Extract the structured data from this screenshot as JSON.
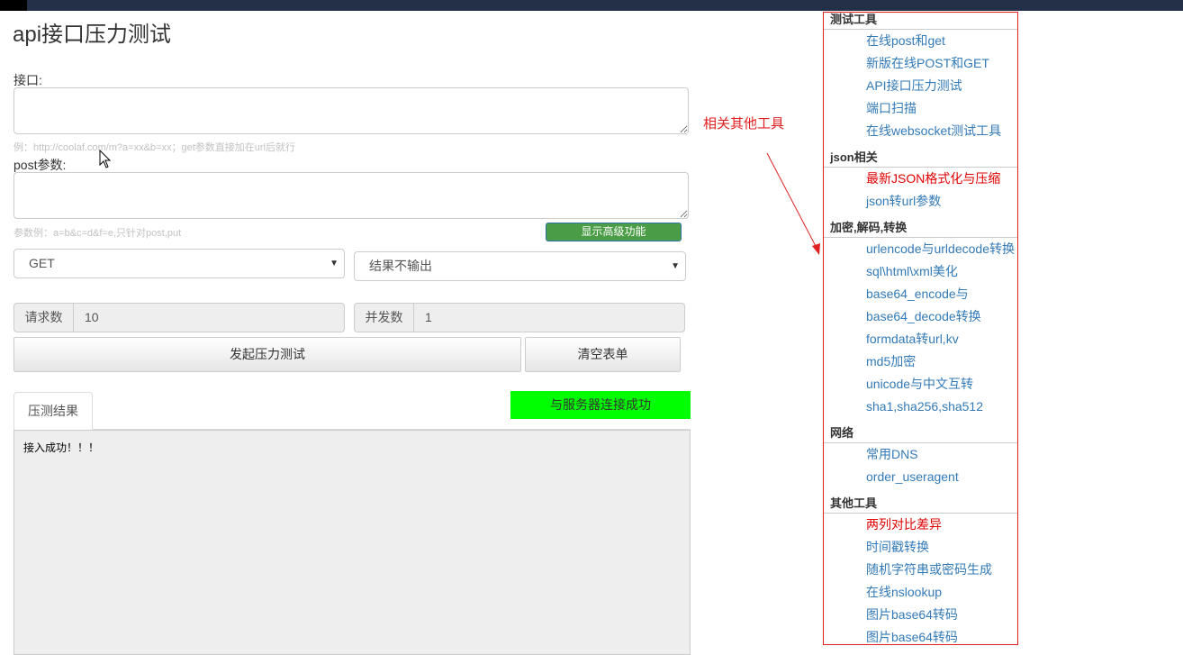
{
  "page": {
    "title": "api接口压力测试",
    "url_label": "接口:",
    "url_hint": "例：http://coolaf.com/m?a=xx&b=xx；get参数直接加在url后就行",
    "post_label": "post参数:",
    "post_hint": "参数例：a=b&c=d&f=e,只针对post,put",
    "advanced_button": "显示高级功能",
    "method_select": "GET",
    "output_select": "结果不输出",
    "request_count_label": "请求数",
    "request_count_value": "10",
    "concurrency_label": "并发数",
    "concurrency_value": "1",
    "start_button": "发起压力测试",
    "clear_button": "清空表单",
    "result_tab": "压测结果",
    "connection_status": "与服务器连接成功",
    "output_text": "接入成功！！！"
  },
  "annotation": {
    "text": "相关其他工具"
  },
  "sidebar": {
    "sections": [
      {
        "title": "测试工具",
        "items": [
          {
            "label": "在线post和get"
          },
          {
            "label": "新版在线POST和GET"
          },
          {
            "label": "API接口压力测试"
          },
          {
            "label": "端口扫描"
          },
          {
            "label": "在线websocket测试工具"
          }
        ]
      },
      {
        "title": "json相关",
        "items": [
          {
            "label": "最新JSON格式化与压缩",
            "highlight": true
          },
          {
            "label": "json转url参数"
          }
        ]
      },
      {
        "title": "加密,解码,转换",
        "items": [
          {
            "label": "urlencode与urldecode转换"
          },
          {
            "label": "sql\\html\\xml美化"
          },
          {
            "label": "base64_encode与"
          },
          {
            "label": "base64_decode转换"
          },
          {
            "label": "formdata转url,kv"
          },
          {
            "label": "md5加密"
          },
          {
            "label": "unicode与中文互转"
          },
          {
            "label": "sha1,sha256,sha512"
          }
        ]
      },
      {
        "title": "网络",
        "items": [
          {
            "label": "常用DNS"
          },
          {
            "label": "order_useragent"
          }
        ]
      },
      {
        "title": "其他工具",
        "items": [
          {
            "label": "两列对比差异",
            "highlight": true
          },
          {
            "label": "时间戳转换"
          },
          {
            "label": "随机字符串或密码生成"
          },
          {
            "label": "在线nslookup"
          },
          {
            "label": "图片base64转码"
          },
          {
            "label": "图片base64转码"
          }
        ]
      }
    ]
  },
  "colors": {
    "link": "#337ab7",
    "highlight": "#e00000",
    "status_green": "#00ff00",
    "advanced_button": "#4a9d46"
  }
}
